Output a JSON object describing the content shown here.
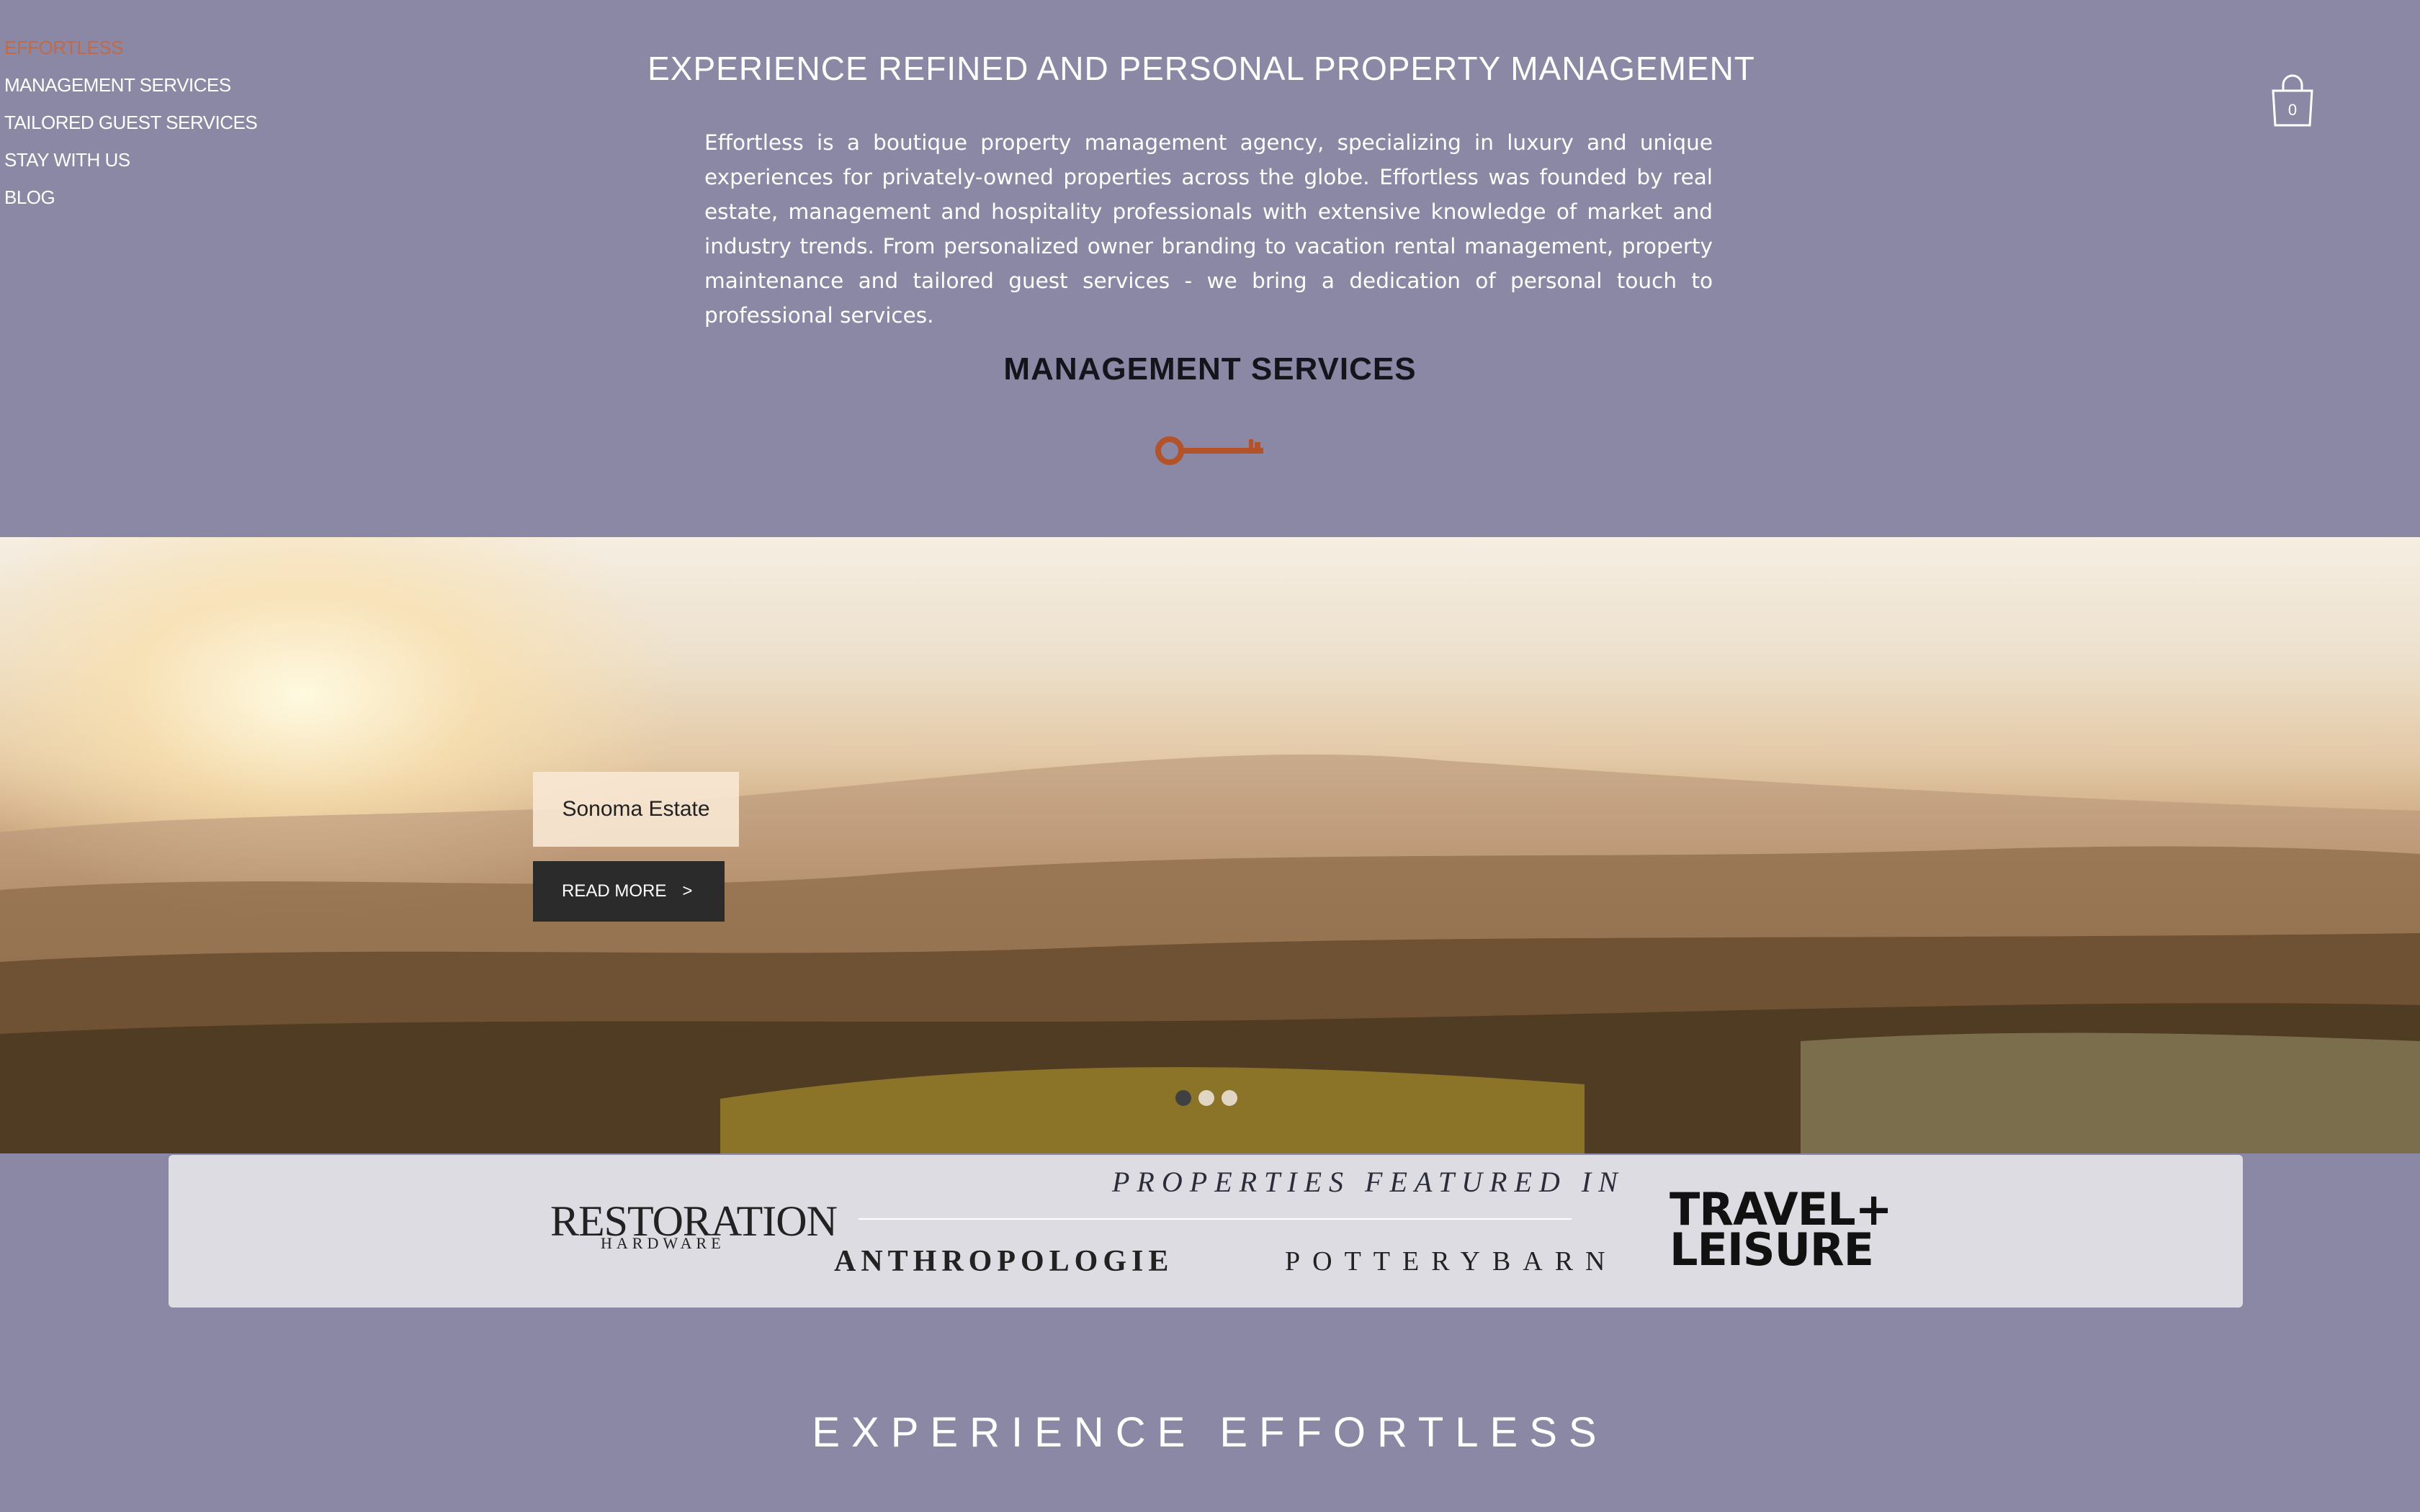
{
  "nav": {
    "items": [
      {
        "label": "Effortless",
        "active": true
      },
      {
        "label": "Management Services"
      },
      {
        "label": "Tailored Guest Services"
      },
      {
        "label": "Stay With Us"
      },
      {
        "label": "Blog"
      }
    ]
  },
  "header": {
    "headline": "Experience Refined and Personal Property Management",
    "intro": "Effortless is a boutique property management agency, specializing in luxury and unique experiences for privately-owned properties across the globe. Effortless was founded by real estate, management and hospitality professionals with extensive knowledge of market and industry trends. From personalized owner branding to vacation rental management, property maintenance and tailored guest services - we bring a dedication of personal touch to professional services.",
    "section_title": "Management Services"
  },
  "cart": {
    "count": "0",
    "icon": "shopping-bag-icon"
  },
  "hero": {
    "label": "Sonoma Estate",
    "button": "READ MORE",
    "button_arrow": ">",
    "slides": 3,
    "active_slide": 1
  },
  "featured": {
    "title": "Properties Featured In",
    "logos": {
      "rh_main": "RESTORATION",
      "rh_sub": "HARDWARE",
      "anthro": "ANTHROPOLOGIE",
      "pb": "POTTERYBARN",
      "tl_line1": "TRAVEL+",
      "tl_line2": "LEISURE"
    }
  },
  "footer": {
    "title": "Experience Effortless"
  },
  "colors": {
    "background": "#8a88a5",
    "accent": "#b4522a",
    "nav_active": "#c06a4a"
  }
}
